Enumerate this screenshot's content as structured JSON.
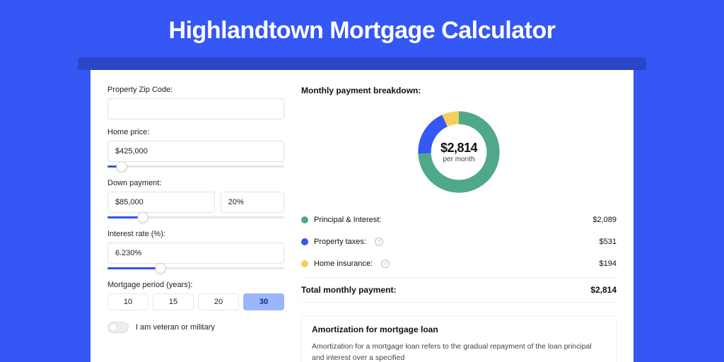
{
  "title": "Highlandtown Mortgage Calculator",
  "colors": {
    "green": "#4fa988",
    "blue": "#3457f5",
    "yellow": "#f3cf5b"
  },
  "form": {
    "zip": {
      "label": "Property Zip Code:",
      "value": ""
    },
    "price": {
      "label": "Home price:",
      "value": "$425,000",
      "slider_pct": 8
    },
    "down": {
      "label": "Down payment:",
      "value": "$85,000",
      "pct_value": "20%",
      "slider_pct": 20
    },
    "rate": {
      "label": "Interest rate (%):",
      "value": "6.230%",
      "slider_pct": 30
    },
    "period": {
      "label": "Mortgage period (years):",
      "options": [
        "10",
        "15",
        "20",
        "30"
      ],
      "selected": "30"
    },
    "veteran": {
      "label": "I am veteran or military",
      "on": false
    }
  },
  "breakdown": {
    "title": "Monthly payment breakdown:",
    "total_amount": "$2,814",
    "per_month": "per month",
    "items": [
      {
        "label": "Principal & Interest:",
        "value": "$2,089",
        "color": "#4fa988",
        "info": false,
        "frac": 0.742
      },
      {
        "label": "Property taxes:",
        "value": "$531",
        "color": "#3457f5",
        "info": true,
        "frac": 0.189
      },
      {
        "label": "Home insurance:",
        "value": "$194",
        "color": "#f3cf5b",
        "info": true,
        "frac": 0.069
      }
    ],
    "total_label": "Total monthly payment:",
    "total_value": "$2,814"
  },
  "amort": {
    "title": "Amortization for mortgage loan",
    "text": "Amortization for a mortgage loan refers to the gradual repayment of the loan principal and interest over a specified"
  }
}
